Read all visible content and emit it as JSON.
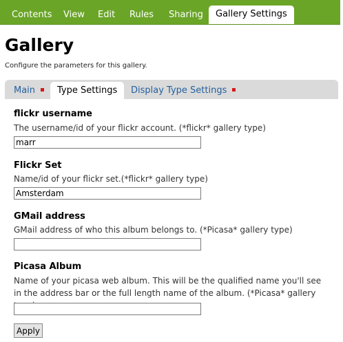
{
  "topnav": {
    "tabs": [
      {
        "label": "Contents"
      },
      {
        "label": "View"
      },
      {
        "label": "Edit"
      },
      {
        "label": "Rules"
      },
      {
        "label": "Sharing"
      },
      {
        "label": "Gallery Settings",
        "active": true
      }
    ]
  },
  "page": {
    "title": "Gallery",
    "description": "Configure the parameters for this gallery."
  },
  "subtabs": [
    {
      "label": "Main",
      "has_marker": true
    },
    {
      "label": "Type Settings",
      "active": true
    },
    {
      "label": "Display Type Settings",
      "has_marker": true
    }
  ],
  "fields": [
    {
      "label": "flickr username",
      "help": "The username/id of your flickr account. (*flickr* gallery type)",
      "value": "marr"
    },
    {
      "label": "Flickr Set",
      "help": "Name/id of your flickr set.(*flickr* gallery type)",
      "value": "Amsterdam"
    },
    {
      "label": "GMail address",
      "help": "GMail address of who this album belongs to. (*Picasa* gallery type)",
      "value": ""
    },
    {
      "label": "Picasa Album",
      "help": "Name of your picasa web album. This will be the qualified name you'll see in the address bar or the full length name of the album. (*Picasa* gallery type)",
      "value": ""
    }
  ],
  "apply_label": "Apply",
  "colors": {
    "nav_green": "#6aa527",
    "link_blue": "#23609e",
    "marker_red": "#d41a1a"
  }
}
